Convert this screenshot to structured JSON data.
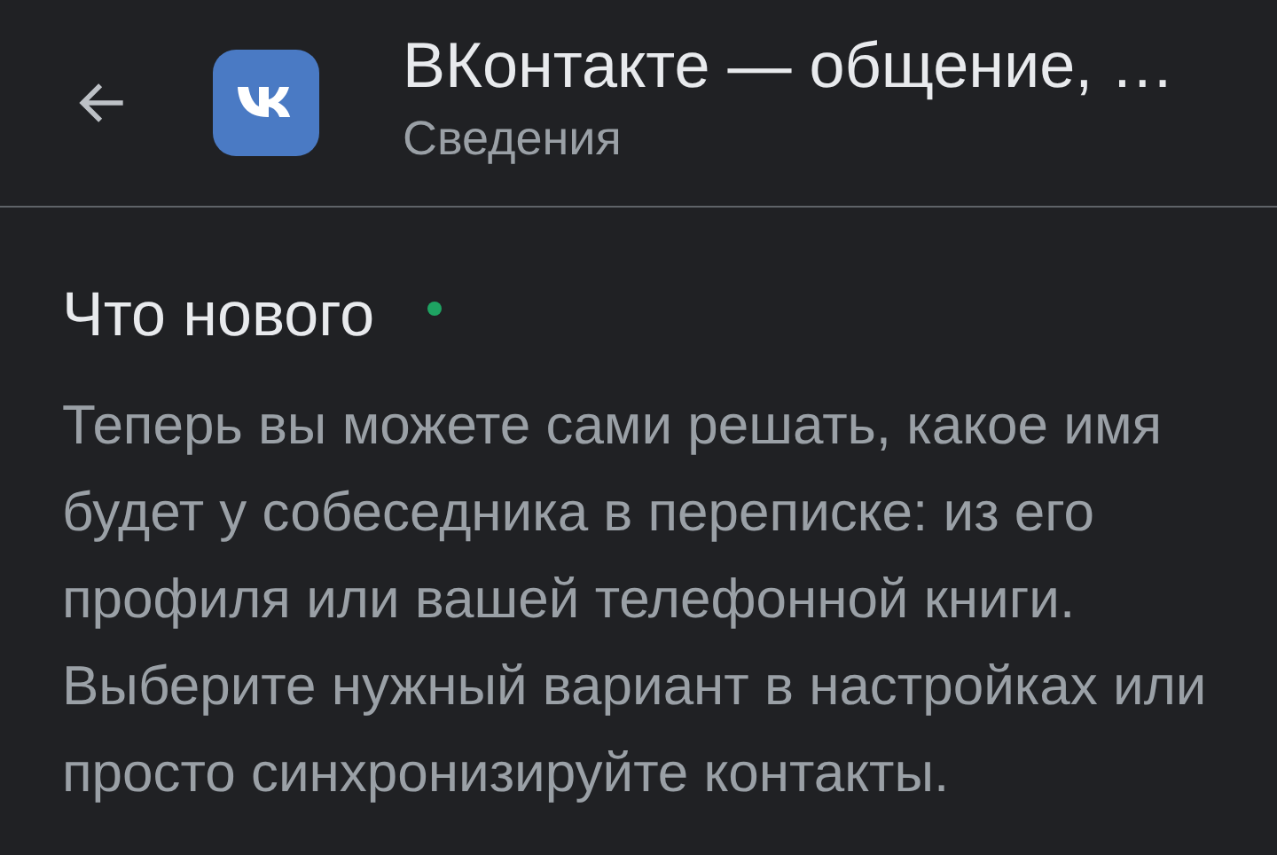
{
  "header": {
    "title": "ВКонтакте — общение, …",
    "subtitle": "Сведения"
  },
  "whats_new": {
    "heading": "Что нового",
    "unread": true,
    "text": "Теперь вы можете сами решать, какое имя будет у собеседника в переписке: из его профиля или вашей телефонной книги. Выберите нужный вариант в настройках или просто синхронизируйте контакты."
  }
}
